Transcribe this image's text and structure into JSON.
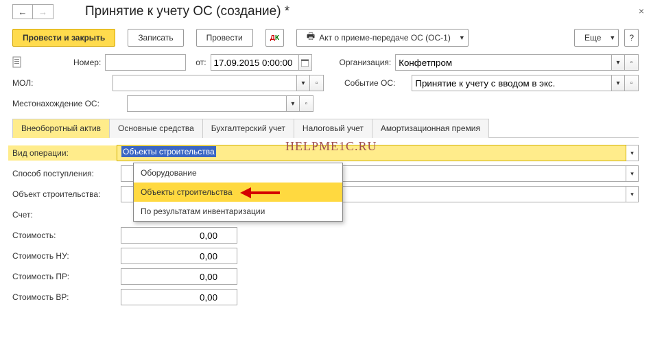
{
  "title": "Принятие к учету ОС (создание) *",
  "toolbar": {
    "post_close": "Провести и закрыть",
    "save": "Записать",
    "post": "Провести",
    "print_act": "Акт о приеме-передаче ОС (ОС-1)",
    "more": "Еще"
  },
  "row1": {
    "number_label": "Номер:",
    "number_value": "",
    "from_label": "от:",
    "date_value": "17.09.2015 0:00:00",
    "org_label": "Организация:",
    "org_value": "Конфетпром"
  },
  "row2": {
    "mol_label": "МОЛ:",
    "mol_value": "",
    "event_label": "Событие ОС:",
    "event_value": "Принятие к учету с вводом в экс."
  },
  "row3": {
    "location_label": "Местонахождение ОС:",
    "location_value": ""
  },
  "tabs": [
    "Внеоборотный актив",
    "Основные средства",
    "Бухгалтерский учет",
    "Налоговый учет",
    "Амортизационная премия"
  ],
  "fields": {
    "op_type_label": "Вид операции:",
    "op_type_value": "Объекты строительства",
    "receipt_label": "Способ поступления:",
    "object_label": "Объект строительства:",
    "account_label": "Счет:",
    "cost_label": "Стоимость:",
    "cost_nu_label": "Стоимость НУ:",
    "cost_pr_label": "Стоимость ПР:",
    "cost_vr_label": "Стоимость ВР:",
    "zero": "0,00"
  },
  "dropdown": {
    "opt1": "Оборудование",
    "opt2": "Объекты строительства",
    "opt3": "По результатам инвентаризации"
  },
  "watermark": "HELPME1C.RU"
}
